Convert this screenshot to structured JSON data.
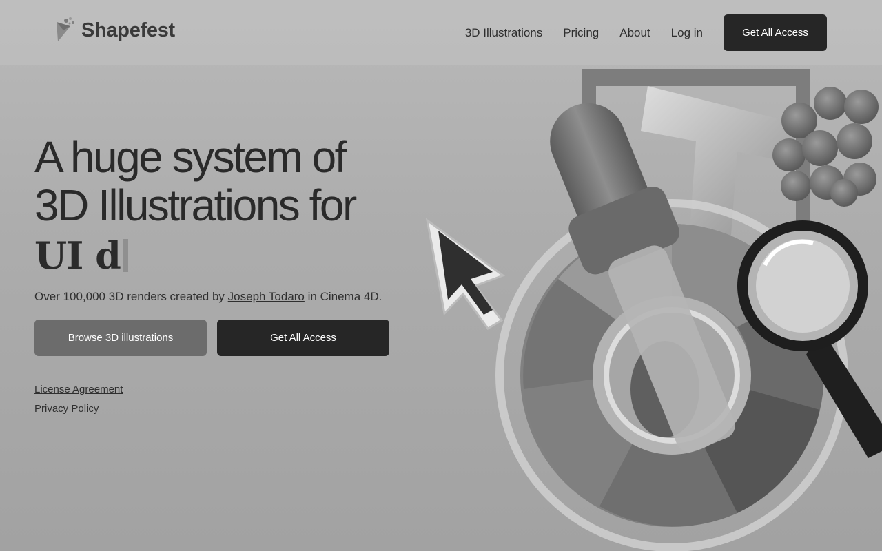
{
  "brand": {
    "name": "Shapefest"
  },
  "nav": {
    "links": [
      "3D Illustrations",
      "Pricing",
      "About",
      "Log in"
    ],
    "cta": "Get All Access"
  },
  "hero": {
    "title_line1": "A huge system of",
    "title_line2": "3D Illustrations for",
    "typed_text": "UI d",
    "subtitle_prefix": "Over 100,000 3D renders created by ",
    "author": "Joseph Todaro",
    "subtitle_suffix": " in Cinema 4D.",
    "browse_button": "Browse 3D illustrations",
    "access_button": "Get All Access"
  },
  "footer": {
    "license": "License Agreement",
    "privacy": "Privacy Policy"
  },
  "illustration": {
    "icons": [
      "cursor-arrow-icon",
      "eyedropper-icon",
      "color-wheel-icon",
      "magnifier-icon",
      "grapes-icon",
      "letter-t-icon"
    ]
  }
}
